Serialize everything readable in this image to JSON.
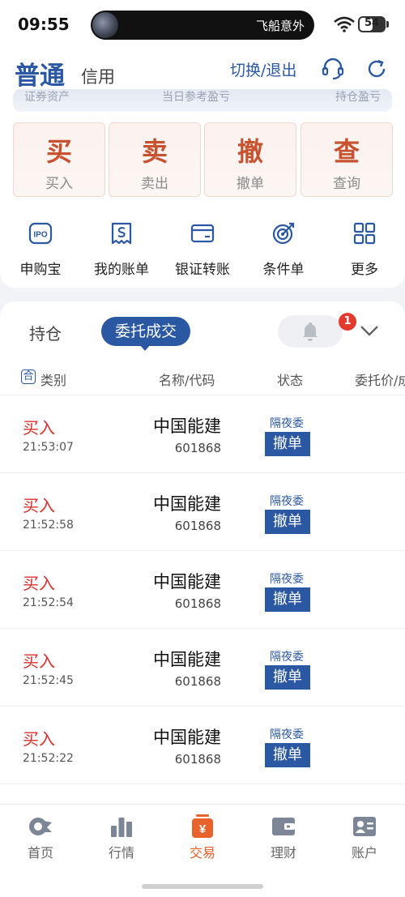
{
  "status_bar": {
    "time": "09:55",
    "ticker": "飞船意外",
    "battery": "54",
    "battery_level": 0.54
  },
  "header": {
    "mode_normal": "普通",
    "mode_credit": "信用",
    "switch_exit": "切换/退出"
  },
  "asset_strip": {
    "left": "证券资产",
    "mid": "当日参考盈亏",
    "right": "持仓盈亏"
  },
  "quick_actions": [
    {
      "big": "买",
      "small": "买入"
    },
    {
      "big": "卖",
      "small": "卖出"
    },
    {
      "big": "撤",
      "small": "撤单"
    },
    {
      "big": "查",
      "small": "查询"
    }
  ],
  "functions": [
    {
      "label": "申购宝",
      "icon": "ipo-icon",
      "icon_text": "IPO"
    },
    {
      "label": "我的账单",
      "icon": "bill-icon"
    },
    {
      "label": "银证转账",
      "icon": "card-icon"
    },
    {
      "label": "条件单",
      "icon": "target-icon"
    },
    {
      "label": "更多",
      "icon": "grid-icon"
    }
  ],
  "tabs": {
    "hold": "持仓",
    "orders": "委托成交"
  },
  "notification_count": "1",
  "columns": {
    "sort_icon": "合",
    "category": "类别",
    "name_code": "名称/代码",
    "status": "状态",
    "price": "委托价/成交价"
  },
  "orders": [
    {
      "side": "买入",
      "time": "21:53:07",
      "name": "中国能建",
      "code": "601868",
      "status": "隔夜委",
      "action": "撤单"
    },
    {
      "side": "买入",
      "time": "21:52:58",
      "name": "中国能建",
      "code": "601868",
      "status": "隔夜委",
      "action": "撤单"
    },
    {
      "side": "买入",
      "time": "21:52:54",
      "name": "中国能建",
      "code": "601868",
      "status": "隔夜委",
      "action": "撤单"
    },
    {
      "side": "买入",
      "time": "21:52:45",
      "name": "中国能建",
      "code": "601868",
      "status": "隔夜委",
      "action": "撤单"
    },
    {
      "side": "买入",
      "time": "21:52:22",
      "name": "中国能建",
      "code": "601868",
      "status": "隔夜委",
      "action": "撤单"
    }
  ],
  "bottom_nav": [
    {
      "label": "首页",
      "icon": "home-icon"
    },
    {
      "label": "行情",
      "icon": "chart-icon"
    },
    {
      "label": "交易",
      "icon": "trade-icon",
      "icon_text": "¥"
    },
    {
      "label": "理财",
      "icon": "wallet-icon"
    },
    {
      "label": "账户",
      "icon": "account-icon"
    }
  ],
  "colors": {
    "brand_blue": "#2b58a3",
    "buy_red": "#d9302a",
    "active_orange": "#e8622c"
  }
}
